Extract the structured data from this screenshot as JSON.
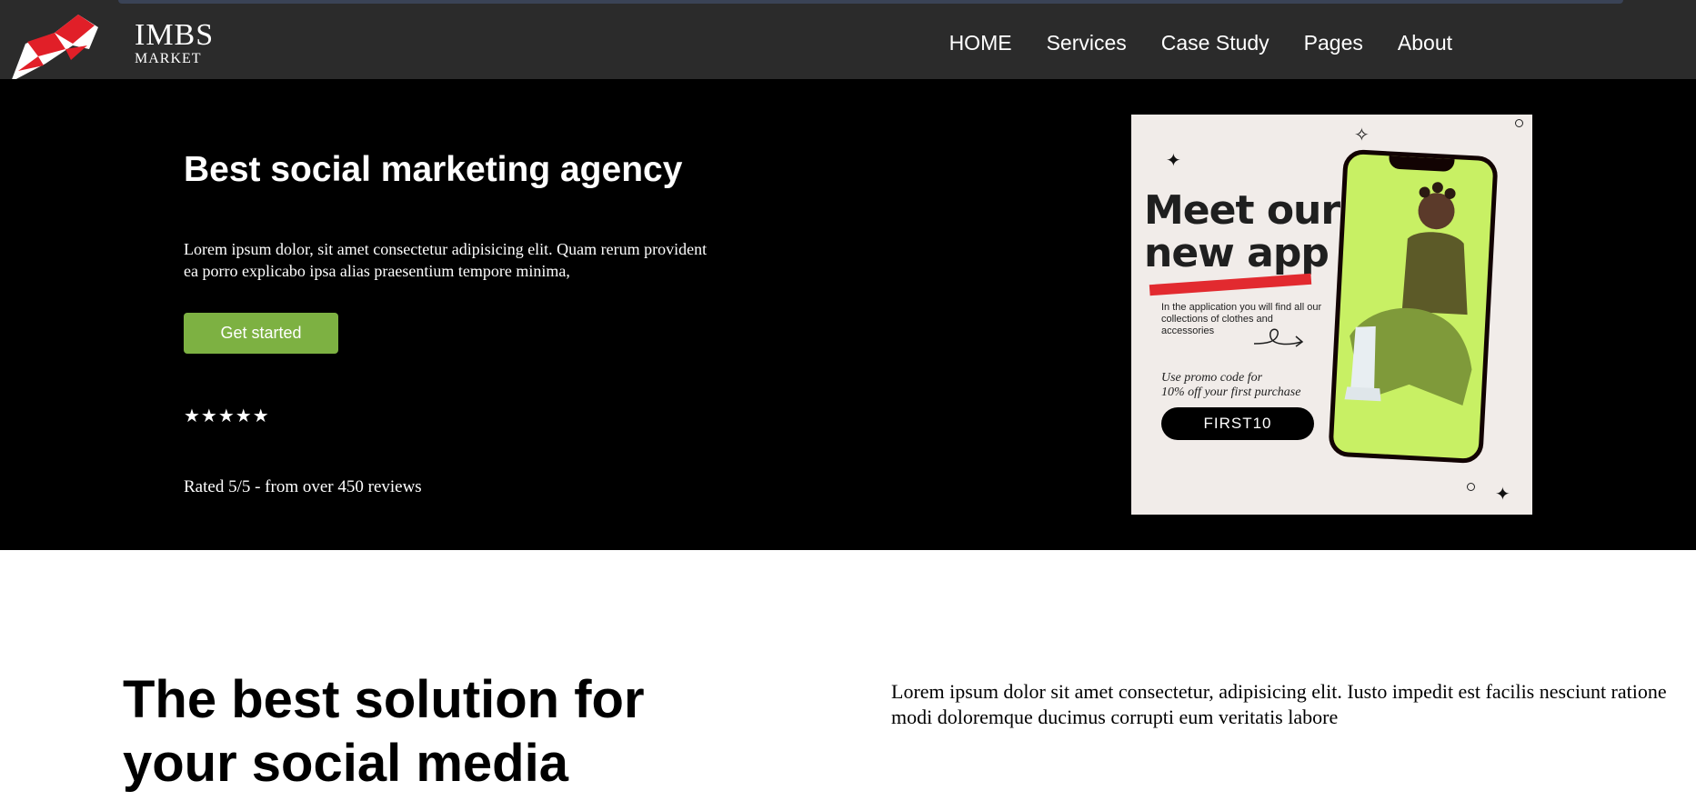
{
  "brand": {
    "name": "IMBS",
    "tagline": "MARKET",
    "logo_icon": "bull-logo-icon"
  },
  "nav": {
    "items": [
      "HOME",
      "Services",
      "Case Study",
      "Pages",
      "About"
    ]
  },
  "hero": {
    "title": "Best social marketing agency",
    "description": "Lorem ipsum dolor, sit amet consectetur adipisicing elit. Quam rerum provident ea porro explicabo ipsa alias praesentium tempore minima,",
    "cta_label": "Get started",
    "stars": "★★★★★",
    "rating_text": "Rated 5/5 - from over 450 reviews"
  },
  "ad": {
    "title_line1": "Meet our",
    "title_line2": "new app",
    "copy": "In the application you will find all our collections of clothes and accessories",
    "promo_line1": "Use promo code for",
    "promo_line2": "10% off your first purchase",
    "code": "FIRST10"
  },
  "section2": {
    "title": "The best solution for your social media",
    "text": "Lorem ipsum dolor sit amet consectetur, adipisicing elit. Iusto impedit est facilis nesciunt ratione modi doloremque ducimus corrupti eum veritatis labore"
  },
  "colors": {
    "nav_bg": "#2b2b2b",
    "hero_bg": "#000000",
    "accent_green": "#7db142",
    "phone_green": "#c8f064",
    "ad_red": "#e22a2f"
  }
}
